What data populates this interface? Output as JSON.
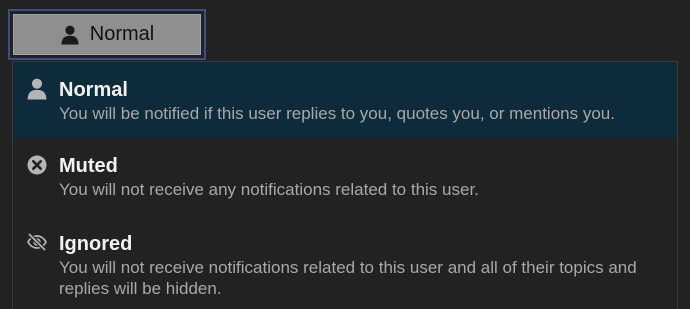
{
  "trigger": {
    "icon": "user-icon",
    "label": "Normal"
  },
  "menu": {
    "items": [
      {
        "icon": "user-icon",
        "title": "Normal",
        "description": "You will be notified if this user replies to you, quotes you, or mentions you.",
        "selected": true
      },
      {
        "icon": "times-circle-icon",
        "title": "Muted",
        "description": "You will not receive any notifications related to this user.",
        "selected": false
      },
      {
        "icon": "eye-slash-icon",
        "title": "Ignored",
        "description": "You will not receive notifications related to this user and all of their topics and replies will be hidden.",
        "selected": false
      }
    ]
  },
  "colors": {
    "background": "#222222",
    "selected_row": "#0d2b3a",
    "trigger_bg": "#8f8f8f",
    "focus_border": "#3d4e86",
    "title": "#f2f2f2",
    "description": "#a8a8a8"
  }
}
